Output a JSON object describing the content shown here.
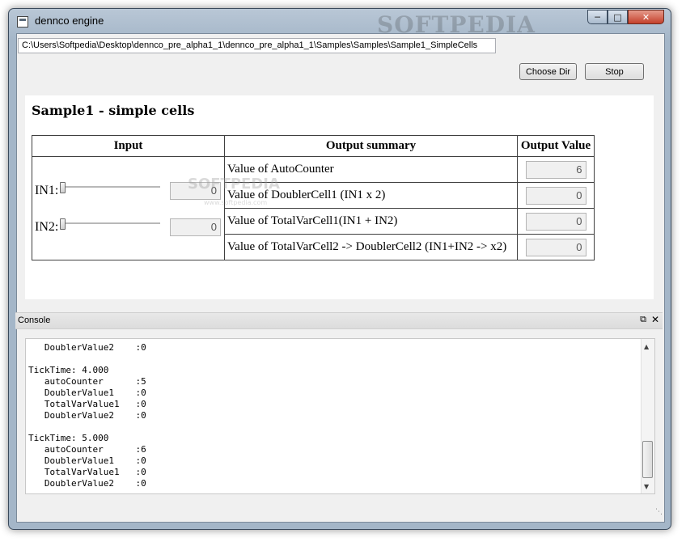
{
  "window": {
    "title": "dennco engine",
    "watermark": "SOFTPEDIA"
  },
  "toolbar": {
    "path": "C:\\Users\\Softpedia\\Desktop\\dennco_pre_alpha1_1\\dennco_pre_alpha1_1\\Samples\\Samples\\Sample1_SimpleCells",
    "choose_label": "Choose Dir",
    "stop_label": "Stop"
  },
  "page": {
    "heading": "Sample1 - simple cells",
    "headers": {
      "input": "Input",
      "summary": "Output summary",
      "value": "Output Value"
    },
    "inputs": [
      {
        "label": "IN1:",
        "value": "0",
        "level": 0
      },
      {
        "label": "IN2:",
        "value": "0",
        "level": 0
      }
    ],
    "outputs": [
      {
        "label": "Value of AutoCounter",
        "value": "6"
      },
      {
        "label": "Value of DoublerCell1 (IN1 x 2)",
        "value": "0"
      },
      {
        "label": "Value of TotalVarCell1(IN1 + IN2)",
        "value": "0"
      },
      {
        "label": "Value of TotalVarCell2 -> DoublerCell2 (IN1+IN2 -> x2)",
        "value": "0"
      }
    ],
    "watermark_main": "SOFTPEDIA",
    "watermark_sub": "www.softpedia.com"
  },
  "console": {
    "title": "Console",
    "lines": "   TotalVarValue1   :0\n   DoublerValue2    :0\n\nTickTime: 4.000\n   autoCounter      :5\n   DoublerValue1    :0\n   TotalVarValue1   :0\n   DoublerValue2    :0\n\nTickTime: 5.000\n   autoCounter      :6\n   DoublerValue1    :0\n   TotalVarValue1   :0\n   DoublerValue2    :0"
  }
}
